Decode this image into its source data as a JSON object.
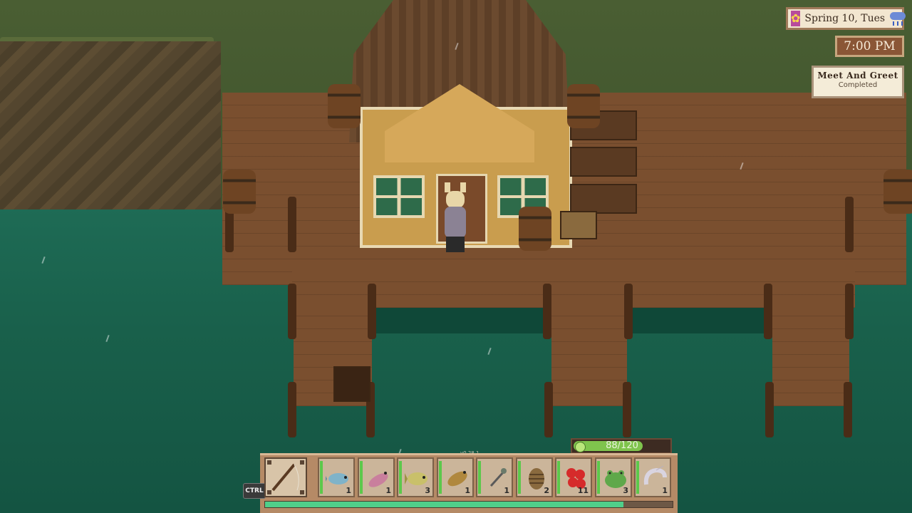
{
  "hud": {
    "date": "Spring 10, Tues",
    "time": "7:00 PM",
    "quest": {
      "title": "Meet And Greet",
      "status": "Completed"
    },
    "energy": {
      "current": 88,
      "max": 120,
      "label": "88/120"
    },
    "version": "v0.28.1",
    "ctrl_key": "CTRL",
    "weather_icon": "rain-icon",
    "season_icon": "flower-icon"
  },
  "hotbar": {
    "selected_tool": "fishing-rod",
    "progress": 0.88,
    "slots": [
      {
        "item": "fish-blue",
        "qty": "1"
      },
      {
        "item": "fish-pink",
        "qty": "1"
      },
      {
        "item": "fish-yellow",
        "qty": "3"
      },
      {
        "item": "fish-orange",
        "qty": "1"
      },
      {
        "item": "bait-hook",
        "qty": "1"
      },
      {
        "item": "pinecone",
        "qty": "2"
      },
      {
        "item": "red-berries",
        "qty": "11"
      },
      {
        "item": "frog",
        "qty": "3"
      },
      {
        "item": "shrimp",
        "qty": "1"
      }
    ]
  },
  "colors": {
    "water": "#19604b",
    "dock": "#7a4f2f",
    "energy": "#7fc44d",
    "hud_time_bg": "#8a5636"
  }
}
